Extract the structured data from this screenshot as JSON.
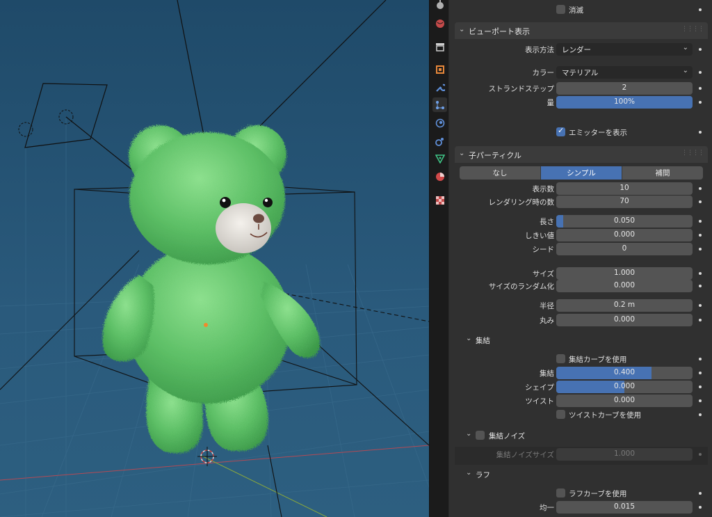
{
  "panel": {
    "top_checkbox": {
      "label": "消滅",
      "checked": false
    },
    "viewport_display": {
      "title": "ビューポート表示",
      "display_method": {
        "label": "表示方法",
        "value": "レンダー"
      },
      "color": {
        "label": "カラー",
        "value": "マテリアル"
      },
      "strand_steps": {
        "label": "ストランドステップ",
        "value": "2"
      },
      "amount": {
        "label": "量",
        "value": "100%",
        "fraction": 1.0
      },
      "show_emitter": {
        "label": "エミッターを表示",
        "checked": true
      }
    },
    "children": {
      "title": "子パーティクル",
      "modes": [
        "なし",
        "シンプル",
        "補間"
      ],
      "active_mode": "シンプル",
      "display_amount": {
        "label": "表示数",
        "value": "10"
      },
      "render_amount": {
        "label": "レンダリング時の数",
        "value": "70"
      },
      "length": {
        "label": "長さ",
        "value": "0.050",
        "fraction": 0.05
      },
      "threshold": {
        "label": "しきい値",
        "value": "0.000"
      },
      "seed": {
        "label": "シード",
        "value": "0"
      },
      "size": {
        "label": "サイズ",
        "value": "1.000"
      },
      "random_size": {
        "label": "サイズのランダム化",
        "value": "0.000"
      },
      "radius": {
        "label": "半径",
        "value": "0.2 m"
      },
      "roundness": {
        "label": "丸み",
        "value": "0.000"
      }
    },
    "clumping": {
      "title": "集結",
      "use_curve": {
        "label": "集結カーブを使用",
        "checked": false
      },
      "clump": {
        "label": "集結",
        "value": "0.400",
        "fraction": 0.7
      },
      "shape": {
        "label": "シェイプ",
        "value": "0.000",
        "fraction": 0.5
      },
      "twist": {
        "label": "ツイスト",
        "value": "0.000"
      },
      "use_twist_curve": {
        "label": "ツイストカーブを使用",
        "checked": false
      }
    },
    "clump_noise": {
      "title": "集結ノイズ",
      "checked": false,
      "size": {
        "label": "集結ノイズサイズ",
        "value": "1.000"
      }
    },
    "roughness": {
      "title": "ラフ",
      "use_curve": {
        "label": "ラフカーブを使用",
        "checked": false
      },
      "uniform": {
        "label": "均一",
        "value": "0.015"
      }
    }
  },
  "tabs": [
    "tool-icon",
    "world-icon",
    "collection-icon",
    "object-icon",
    "modifier-icon",
    "particles-icon",
    "physics-icon",
    "constraints-icon",
    "data-icon",
    "material-icon",
    "texture-icon"
  ],
  "colors": {
    "accent": "#4772b3",
    "panel": "#303030",
    "field": "#545454",
    "viewport": "#2a5a7c",
    "fur": "#5fc46a"
  }
}
